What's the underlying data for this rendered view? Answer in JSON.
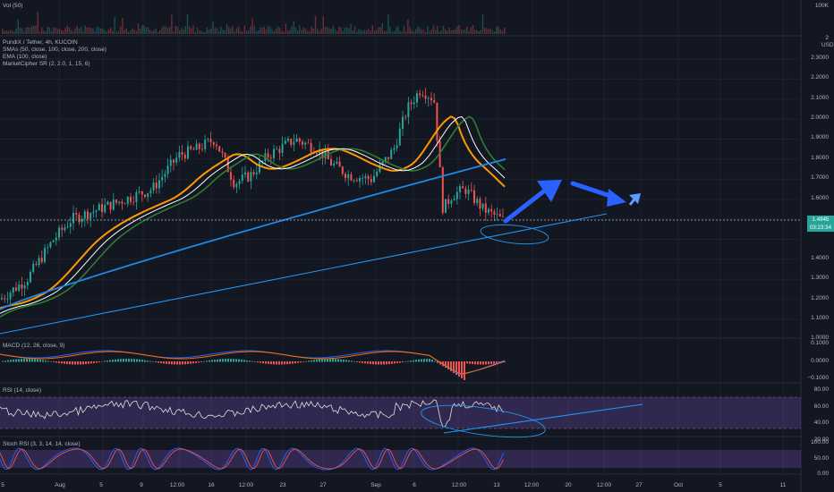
{
  "panes": {
    "volume": {
      "label": "Vol (50)",
      "scale_top": "100K"
    },
    "main": {
      "title": "PundiX / Tether, 4h, KUCOIN",
      "indicators": [
        "SMAs (50, close, 100, close, 200, close)",
        "EMA (100, close)",
        "MarketCipher SR (2, 2.0, 1, 15, 6)"
      ],
      "currency": "USDT",
      "price_ticks": [
        "2",
        "2.3000",
        "2.2000",
        "2.1000",
        "2.0000",
        "1.9000",
        "1.8000",
        "1.7000",
        "1.6000",
        "1.4000",
        "1.3000",
        "1.2000",
        "1.1000",
        "1.0000"
      ],
      "last_price": "1.4945",
      "countdown": "03:23:34"
    },
    "macd": {
      "label": "MACD (12, 26, close, 9)",
      "ticks": [
        "0.1000",
        "0.0000",
        "−0.1000"
      ]
    },
    "rsi": {
      "label": "RSI (14, close)",
      "ticks": [
        "80.00",
        "60.00",
        "40.00",
        "20.00"
      ]
    },
    "stoch": {
      "label": "Stoch RSI (3, 3, 14, 14, close)",
      "ticks": [
        "100.00",
        "50.00",
        "0.00"
      ]
    }
  },
  "time_axis": [
    "5",
    "Aug",
    "5",
    "9",
    "12:00",
    "16",
    "12:00",
    "23",
    "27",
    "Sep",
    "6",
    "12:00",
    "13",
    "12:00",
    "20",
    "12:00",
    "27",
    "Oct",
    "5",
    "11"
  ],
  "colors": {
    "background": "#131722",
    "grid": "#1e222d",
    "up": "#26a69a",
    "down": "#ef5350",
    "sma50": "#ff9800",
    "sma100": "#2e7d32",
    "sma200": "#1e88e5",
    "ema100": "#ffffff",
    "rsi_band": "#7e57c2",
    "trend": "#2196f3"
  }
}
